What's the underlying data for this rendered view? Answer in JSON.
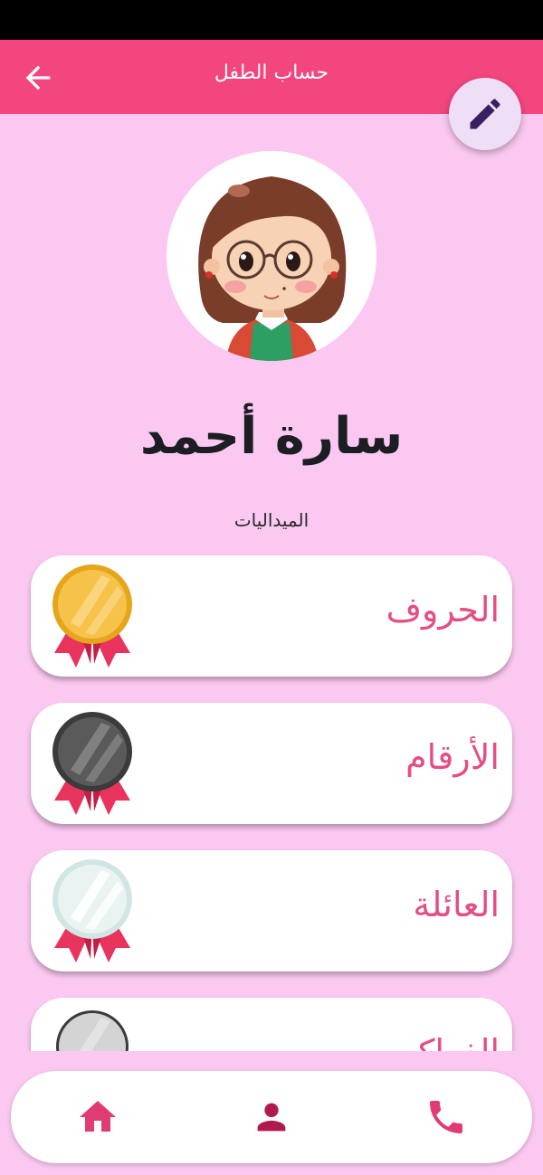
{
  "app_bar": {
    "title": "حساب الطفل"
  },
  "profile": {
    "name": "سارة أحمد",
    "medals_label": "الميداليات"
  },
  "medals": [
    {
      "label": "الحروف",
      "medal": "gold-medal-icon"
    },
    {
      "label": "الأرقام",
      "medal": "dark-medal-icon"
    },
    {
      "label": "العائلة",
      "medal": "silver-medal-icon"
    },
    {
      "label": "الفواكه",
      "medal": "grey-medal-icon"
    }
  ],
  "colors": {
    "accent": "#f3457e",
    "background": "#fbc8f1",
    "label_pink": "#e54d86",
    "fab": "#efdff6",
    "pen": "#3b1f63"
  },
  "bottom_nav": {
    "items": [
      "home-icon",
      "person-icon",
      "phone-icon"
    ]
  }
}
